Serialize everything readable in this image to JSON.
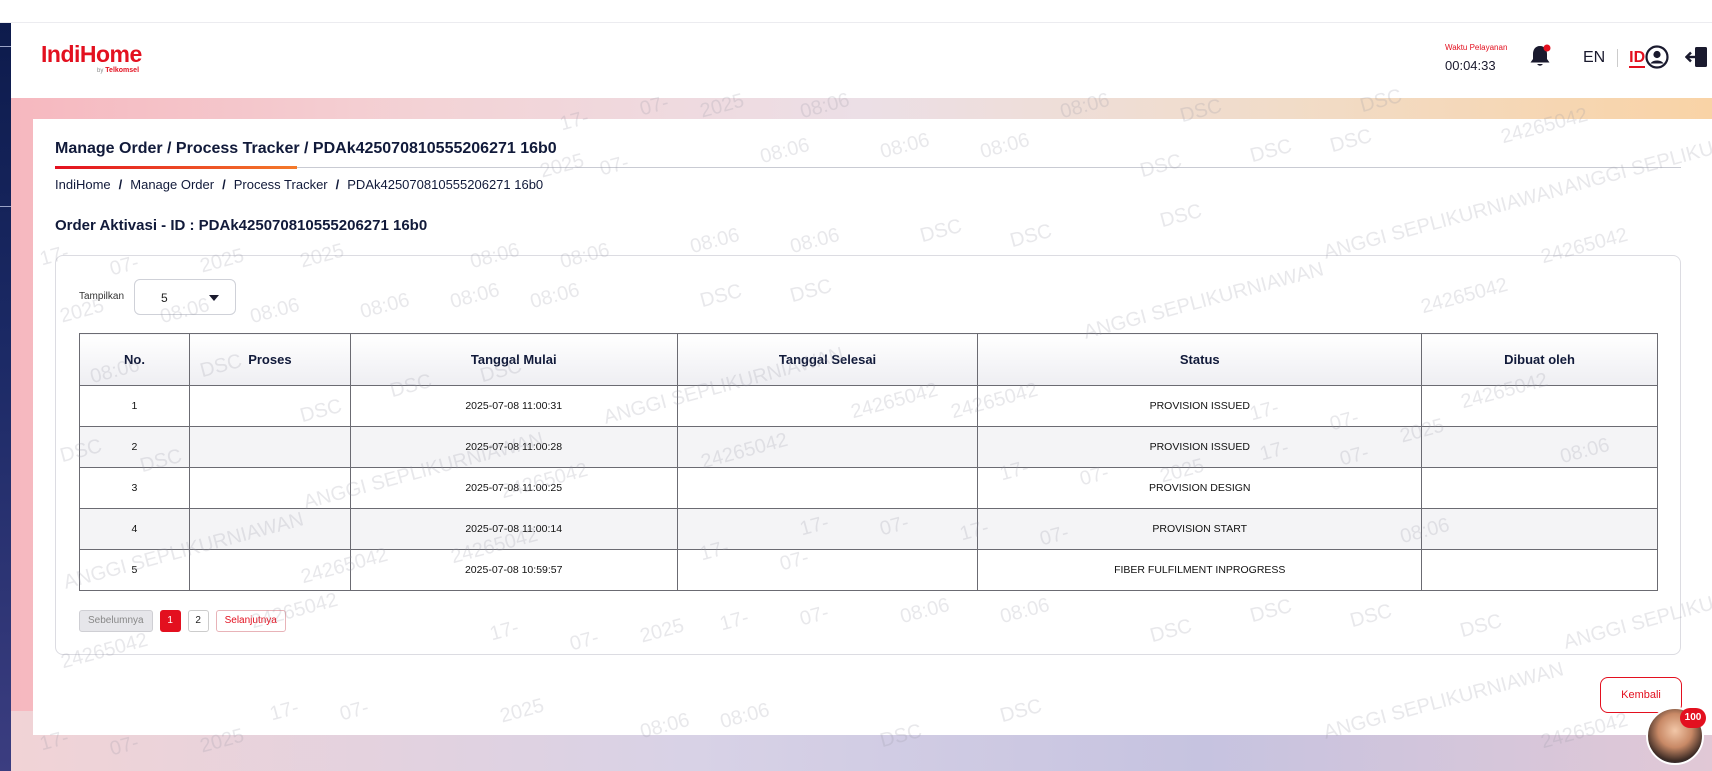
{
  "header": {
    "logo_text": "IndiHome",
    "logo_sub_by": "by",
    "logo_sub_brand": "Telkomsel",
    "service_time_label": "Waktu Pelayanan",
    "service_time_value": "00:04:33",
    "lang_en": "EN",
    "lang_id": "ID",
    "active_lang": "ID"
  },
  "page": {
    "title": "Manage Order / Process Tracker / PDAk425070810555206271 16b0",
    "breadcrumb": [
      "IndiHome",
      "Manage Order",
      "Process Tracker",
      "PDAk425070810555206271 16b0"
    ],
    "order_title": "Order Aktivasi - ID : PDAk425070810555206271 16b0"
  },
  "table": {
    "show_label": "Tampilkan",
    "show_value": "5",
    "columns": [
      "No.",
      "Proses",
      "Tanggal Mulai",
      "Tanggal Selesai",
      "Status",
      "Dibuat oleh"
    ],
    "rows": [
      {
        "no": "1",
        "proses": "",
        "mulai": "2025-07-08 11:00:31",
        "selesai": "",
        "status": "PROVISION ISSUED",
        "oleh": ""
      },
      {
        "no": "2",
        "proses": "",
        "mulai": "2025-07-08 11:00:28",
        "selesai": "",
        "status": "PROVISION ISSUED",
        "oleh": ""
      },
      {
        "no": "3",
        "proses": "",
        "mulai": "2025-07-08 11:00:25",
        "selesai": "",
        "status": "PROVISION DESIGN",
        "oleh": ""
      },
      {
        "no": "4",
        "proses": "",
        "mulai": "2025-07-08 11:00:14",
        "selesai": "",
        "status": "PROVISION START",
        "oleh": ""
      },
      {
        "no": "5",
        "proses": "",
        "mulai": "2025-07-08 10:59:57",
        "selesai": "",
        "status": "FIBER FULFILMENT INPROGRESS",
        "oleh": ""
      }
    ]
  },
  "pagination": {
    "prev_label": "Sebelumnya",
    "pages": [
      "1",
      "2"
    ],
    "current": "1",
    "next_label": "Selanjutnya"
  },
  "actions": {
    "back_label": "Kembali"
  },
  "chat_avatar": {
    "badge": "100"
  },
  "watermark": {
    "texts": [
      "17-",
      "07-",
      "2025",
      "08:06",
      "DSC",
      "ANGGI SEPLIKURNIAWAN",
      "24265042"
    ]
  },
  "colors": {
    "brand_red": "#e3101f",
    "navy": "#111a3a",
    "accent_orange": "#f47a2a"
  },
  "icons": {
    "bell": "bell-icon",
    "user": "user-circle-icon",
    "logout": "logout-icon",
    "caret": "chevron-down-icon"
  }
}
